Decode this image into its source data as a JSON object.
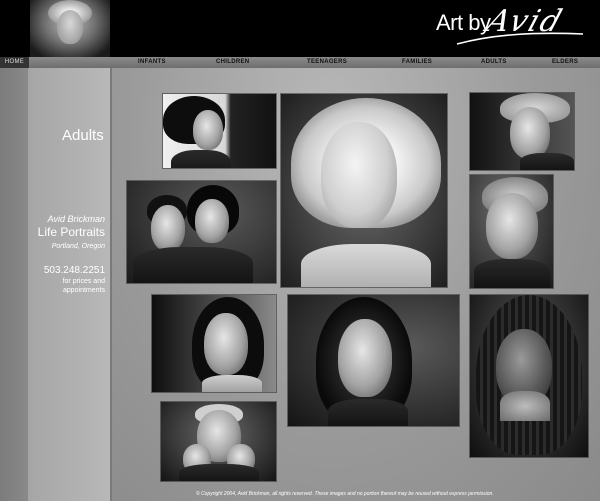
{
  "header": {
    "logo_prefix": "Art by",
    "logo_signature": "Avid"
  },
  "nav": {
    "home": "HOME",
    "items": [
      "INFANTS",
      "CHILDREN",
      "TEENAGERS",
      "FAMILIES",
      "ADULTS",
      "ELDERS"
    ]
  },
  "sidebar": {
    "section_title": "Adults",
    "studio_name": "Avid Brickman",
    "studio_sub": "Life Portraits",
    "location": "Portland, Oregon",
    "phone": "503.248.2251",
    "phone_note": "for prices and appointments"
  },
  "footer": {
    "copyright": "© Copyright 2004, Avid Brickman, all rights reserved. These images and no portion thereof may be reused without express permission."
  }
}
